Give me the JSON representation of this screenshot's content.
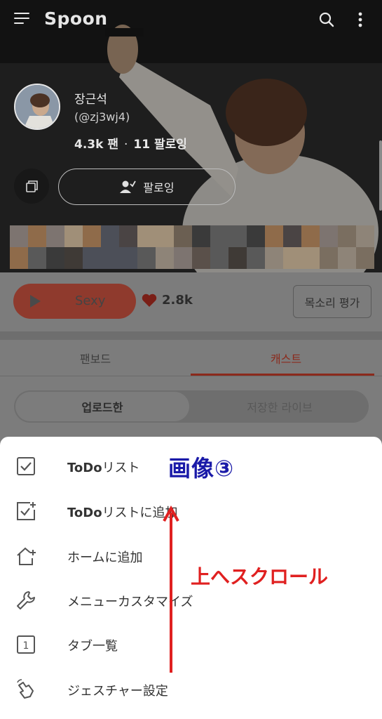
{
  "app": {
    "logo": "Spoon"
  },
  "profile": {
    "name": "장근석",
    "handle": "(@zj3wj4)",
    "fans": "4.3k 팬",
    "following": "11 팔로잉",
    "follow_label": "팔로잉"
  },
  "actions": {
    "play_label": "Sexy",
    "like_count": "2.8k",
    "review_label": "목소리 평가"
  },
  "tabs": [
    {
      "label": "팬보드",
      "active": false
    },
    {
      "label": "캐스트",
      "active": true
    }
  ],
  "segments": [
    {
      "label": "업로드한",
      "active": true
    },
    {
      "label": "저장한 라이브",
      "active": false
    }
  ],
  "sheet": {
    "items": [
      {
        "prefix": "ToDo",
        "label": "リスト",
        "icon": "checkbox-icon"
      },
      {
        "prefix": "ToDo",
        "label": "リストに追加",
        "icon": "checkbox-add-icon"
      },
      {
        "prefix": "",
        "label": "ホームに追加",
        "icon": "home-add-icon"
      },
      {
        "prefix": "",
        "label": "メニューカスタマイズ",
        "icon": "wrench-icon"
      },
      {
        "prefix": "",
        "label": "タブ一覧",
        "icon": "tab-count-icon"
      },
      {
        "prefix": "",
        "label": "ジェスチャー設定",
        "icon": "gesture-hand-icon"
      }
    ]
  },
  "annotations": {
    "title": "画像③",
    "scroll_hint": "上へスクロール"
  },
  "colors": {
    "accent": "#d9432f",
    "annotation_blue": "#1a1aa8",
    "annotation_red": "#e02020"
  }
}
